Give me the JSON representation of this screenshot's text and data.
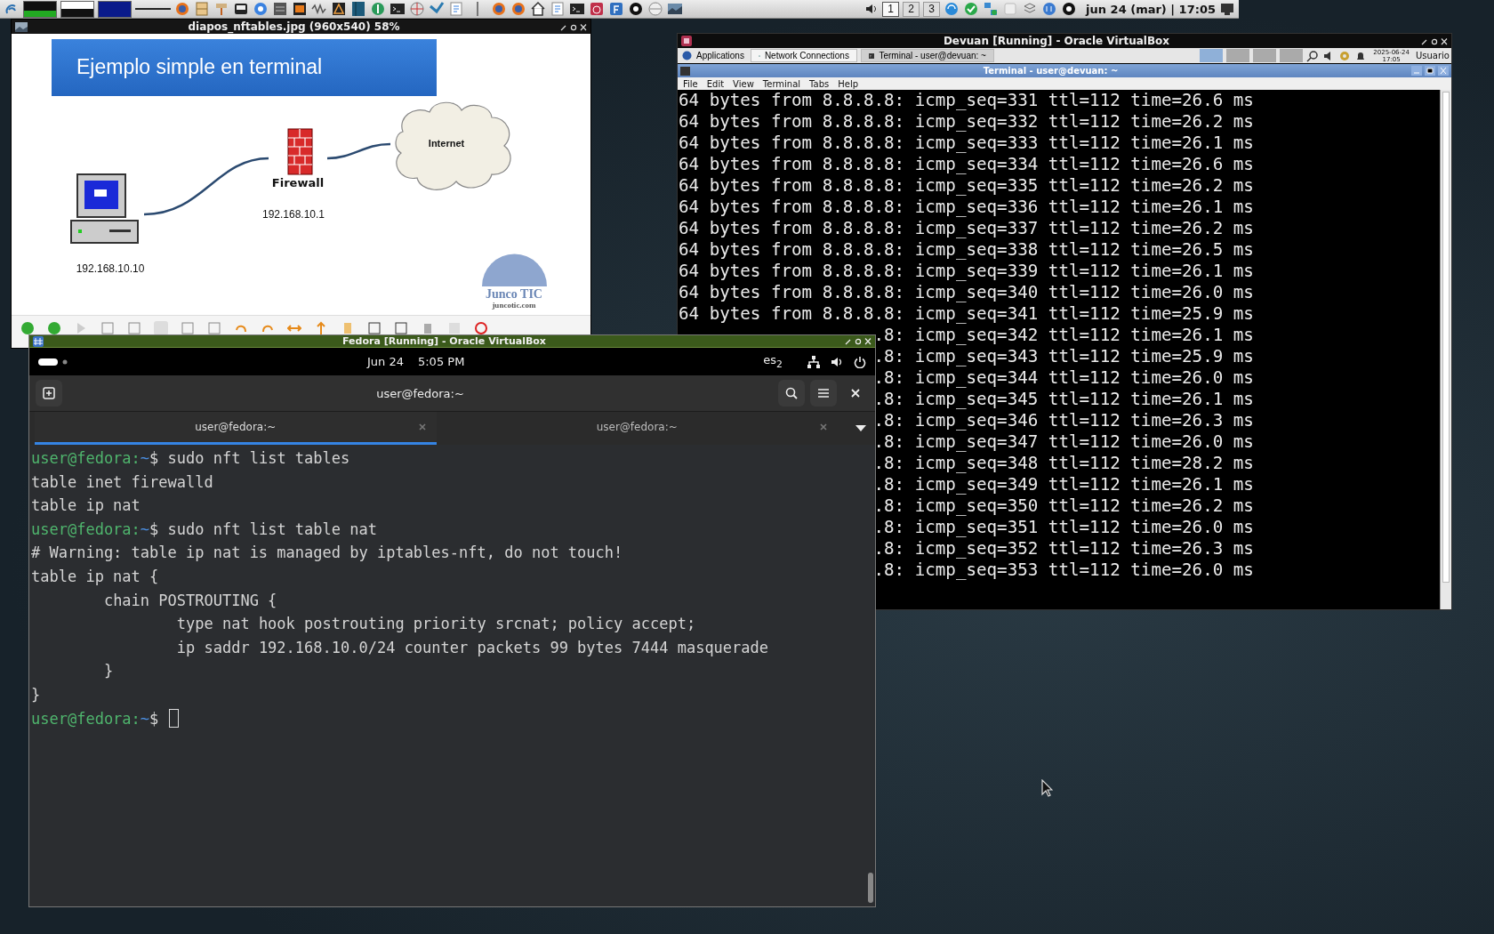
{
  "top_panel": {
    "workspaces": [
      {
        "label": "1",
        "selected": true
      },
      {
        "label": "2",
        "selected": false
      },
      {
        "label": "3",
        "selected": false
      }
    ],
    "clock": "jun 24 (mar) | 17:05"
  },
  "image_viewer": {
    "title": "diapos_nftables.jpg (960x540) 58%",
    "slide": {
      "title": "Ejemplo simple en terminal",
      "cloud_label": "Internet",
      "firewall_label": "Firewall",
      "firewall_ip": "192.168.10.1",
      "host_ip": "192.168.10.10",
      "logo_name": "Junco TIC",
      "logo_url": "juncotic.com"
    }
  },
  "devuan_window": {
    "title": "Devuan [Running] - Oracle VirtualBox",
    "panel": {
      "menu": "Applications",
      "tasks": [
        {
          "label": "Network Connections",
          "selected": false
        },
        {
          "label": "Terminal - user@devuan: ~",
          "selected": true
        }
      ],
      "date": "2025-06-24",
      "time": "17:05",
      "user": "Usuario"
    },
    "terminal": {
      "title": "Terminal - user@devuan: ~",
      "menu": [
        "File",
        "Edit",
        "View",
        "Terminal",
        "Tabs",
        "Help"
      ],
      "lines": [
        {
          "text": "64 bytes from 8.8.8.8: icmp_seq=331 ttl=112 time=26.6 ms",
          "covered": false
        },
        {
          "text": "64 bytes from 8.8.8.8: icmp_seq=332 ttl=112 time=26.2 ms",
          "covered": false
        },
        {
          "text": "64 bytes from 8.8.8.8: icmp_seq=333 ttl=112 time=26.1 ms",
          "covered": false
        },
        {
          "text": "64 bytes from 8.8.8.8: icmp_seq=334 ttl=112 time=26.6 ms",
          "covered": false
        },
        {
          "text": "64 bytes from 8.8.8.8: icmp_seq=335 ttl=112 time=26.2 ms",
          "covered": false
        },
        {
          "text": "64 bytes from 8.8.8.8: icmp_seq=336 ttl=112 time=26.1 ms",
          "covered": false
        },
        {
          "text": "64 bytes from 8.8.8.8: icmp_seq=337 ttl=112 time=26.2 ms",
          "covered": false
        },
        {
          "text": "64 bytes from 8.8.8.8: icmp_seq=338 ttl=112 time=26.5 ms",
          "covered": false
        },
        {
          "text": "64 bytes from 8.8.8.8: icmp_seq=339 ttl=112 time=26.1 ms",
          "covered": false
        },
        {
          "text": "64 bytes from 8.8.8.8: icmp_seq=340 ttl=112 time=26.0 ms",
          "covered": false
        },
        {
          "text": "64 bytes from 8.8.8.8: icmp_seq=341 ttl=112 time=25.9 ms",
          "covered": false
        },
        {
          "text": ".8: icmp_seq=342 ttl=112 time=26.1 ms",
          "covered": true
        },
        {
          "text": ".8: icmp_seq=343 ttl=112 time=25.9 ms",
          "covered": true
        },
        {
          "text": ".8: icmp_seq=344 ttl=112 time=26.0 ms",
          "covered": true
        },
        {
          "text": ".8: icmp_seq=345 ttl=112 time=26.1 ms",
          "covered": true
        },
        {
          "text": ".8: icmp_seq=346 ttl=112 time=26.3 ms",
          "covered": true
        },
        {
          "text": ".8: icmp_seq=347 ttl=112 time=26.0 ms",
          "covered": true
        },
        {
          "text": ".8: icmp_seq=348 ttl=112 time=28.2 ms",
          "covered": true
        },
        {
          "text": ".8: icmp_seq=349 ttl=112 time=26.1 ms",
          "covered": true
        },
        {
          "text": ".8: icmp_seq=350 ttl=112 time=26.2 ms",
          "covered": true
        },
        {
          "text": ".8: icmp_seq=351 ttl=112 time=26.0 ms",
          "covered": true
        },
        {
          "text": ".8: icmp_seq=352 ttl=112 time=26.3 ms",
          "covered": true
        },
        {
          "text": ".8: icmp_seq=353 ttl=112 time=26.0 ms",
          "covered": true
        }
      ]
    }
  },
  "fedora_window": {
    "title": "Fedora [Running] - Oracle VirtualBox",
    "top_bar": {
      "date": "Jun 24",
      "time": "5:05 PM",
      "keyboard": "es$_{2}$"
    },
    "header_title": "user@fedora:~",
    "tabs": [
      {
        "label": "user@fedora:~",
        "selected": true
      },
      {
        "label": "user@fedora:~",
        "selected": false
      }
    ],
    "terminal": {
      "lines": [
        {
          "kind": "prompt",
          "user": "user@fedora:",
          "path": "~",
          "symbol": "$",
          "command": "sudo nft list tables",
          "cursor": false
        },
        {
          "kind": "output",
          "text": "table inet firewalld"
        },
        {
          "kind": "output",
          "text": "table ip nat"
        },
        {
          "kind": "prompt",
          "user": "user@fedora:",
          "path": "~",
          "symbol": "$",
          "command": "sudo nft list table nat",
          "cursor": false
        },
        {
          "kind": "output",
          "text": "# Warning: table ip nat is managed by iptables-nft, do not touch!"
        },
        {
          "kind": "output",
          "text": "table ip nat {"
        },
        {
          "kind": "output",
          "text": "\tchain POSTROUTING {"
        },
        {
          "kind": "output",
          "text": "\t\ttype nat hook postrouting priority srcnat; policy accept;"
        },
        {
          "kind": "output",
          "text": "\t\tip saddr 192.168.10.0/24 counter packets 99 bytes 7444 masquerade"
        },
        {
          "kind": "output",
          "text": "\t}"
        },
        {
          "kind": "output",
          "text": "}"
        },
        {
          "kind": "prompt",
          "user": "user@fedora:",
          "path": "~",
          "symbol": "$",
          "cursor": true
        }
      ]
    }
  }
}
